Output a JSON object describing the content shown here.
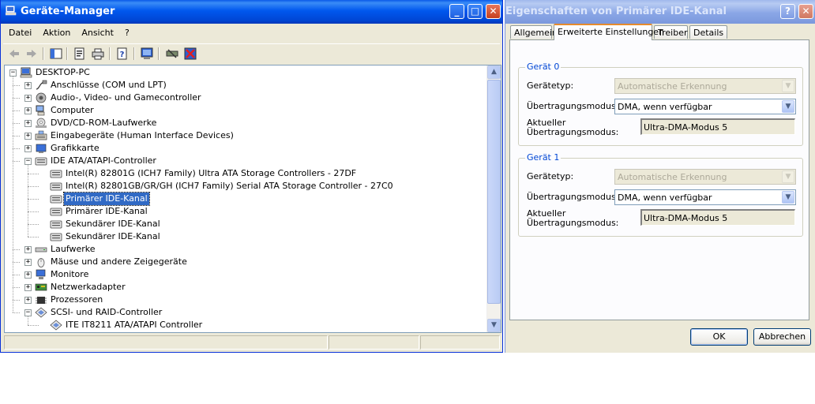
{
  "device_manager": {
    "title": "Geräte-Manager",
    "menu": [
      "Datei",
      "Aktion",
      "Ansicht",
      "?"
    ],
    "toolbar_icons": [
      "back-arrow-icon",
      "forward-arrow-icon",
      "show-hide-console-tree-icon",
      "properties-icon",
      "print-icon",
      "help-icon",
      "scan-hardware-icon",
      "disable-device-icon",
      "uninstall-device-icon"
    ],
    "tree": [
      {
        "label": "DESKTOP-PC",
        "level": 0,
        "expander": "−",
        "icon": "computer-icon"
      },
      {
        "label": "Anschlüsse (COM und LPT)",
        "level": 1,
        "expander": "+",
        "icon": "port-connector-icon"
      },
      {
        "label": "Audio-, Video- und Gamecontroller",
        "level": 1,
        "expander": "+",
        "icon": "speaker-icon"
      },
      {
        "label": "Computer",
        "level": 1,
        "expander": "+",
        "icon": "computer-tower-icon"
      },
      {
        "label": "DVD/CD-ROM-Laufwerke",
        "level": 1,
        "expander": "+",
        "icon": "cd-drive-icon"
      },
      {
        "label": "Eingabegeräte (Human Interface Devices)",
        "level": 1,
        "expander": "+",
        "icon": "keyboard-icon"
      },
      {
        "label": "Grafikkarte",
        "level": 1,
        "expander": "+",
        "icon": "display-adapter-icon"
      },
      {
        "label": "IDE ATA/ATAPI-Controller",
        "level": 1,
        "expander": "−",
        "icon": "ide-controller-icon"
      },
      {
        "label": "Intel(R) 82801G (ICH7 Family) Ultra ATA Storage Controllers - 27DF",
        "level": 2,
        "icon": "ide-controller-icon"
      },
      {
        "label": "Intel(R) 82801GB/GR/GH (ICH7 Family) Serial ATA Storage Controller - 27C0",
        "level": 2,
        "icon": "ide-controller-icon"
      },
      {
        "label": "Primärer IDE-Kanal",
        "level": 2,
        "icon": "ide-controller-icon",
        "selected": true
      },
      {
        "label": "Primärer IDE-Kanal",
        "level": 2,
        "icon": "ide-controller-icon"
      },
      {
        "label": "Sekundärer IDE-Kanal",
        "level": 2,
        "icon": "ide-controller-icon"
      },
      {
        "label": "Sekundärer IDE-Kanal",
        "level": 2,
        "icon": "ide-controller-icon"
      },
      {
        "label": "Laufwerke",
        "level": 1,
        "expander": "+",
        "icon": "hard-drive-icon"
      },
      {
        "label": "Mäuse und andere Zeigegeräte",
        "level": 1,
        "expander": "+",
        "icon": "mouse-icon"
      },
      {
        "label": "Monitore",
        "level": 1,
        "expander": "+",
        "icon": "monitor-icon"
      },
      {
        "label": "Netzwerkadapter",
        "level": 1,
        "expander": "+",
        "icon": "network-card-icon"
      },
      {
        "label": "Prozessoren",
        "level": 1,
        "expander": "+",
        "icon": "processor-icon"
      },
      {
        "label": "SCSI- und RAID-Controller",
        "level": 1,
        "expander": "−",
        "icon": "scsi-controller-icon"
      },
      {
        "label": "ITE IT8211 ATA/ATAPI Controller",
        "level": 2,
        "icon": "scsi-controller-icon"
      }
    ]
  },
  "properties": {
    "title": "Eigenschaften von Primärer IDE-Kanal",
    "tabs": [
      "Allgemein",
      "Erweiterte Einstellungen",
      "Treiber",
      "Details"
    ],
    "active_tab": "Erweiterte Einstellungen",
    "groups": [
      {
        "legend": "Gerät 0",
        "device_type_label": "Gerätetyp:",
        "device_type_value": "Automatische Erkennung",
        "transfer_mode_label": "Übertragungsmodus:",
        "transfer_mode_value": "DMA, wenn verfügbar",
        "current_mode_label": "Aktueller Übertragungsmodus:",
        "current_mode_value": "Ultra-DMA-Modus 5"
      },
      {
        "legend": "Gerät 1",
        "device_type_label": "Gerätetyp:",
        "device_type_value": "Automatische Erkennung",
        "transfer_mode_label": "Übertragungsmodus:",
        "transfer_mode_value": "DMA, wenn verfügbar",
        "current_mode_label": "Aktueller Übertragungsmodus:",
        "current_mode_value": "Ultra-DMA-Modus 5"
      }
    ],
    "buttons": {
      "ok": "OK",
      "cancel": "Abbrechen"
    }
  },
  "colors": {
    "titlebar_active": "#0058ee",
    "selection": "#316ac5",
    "window_face": "#ece9d8",
    "group_legend": "#0046d5",
    "active_tab_highlight": "#e68b2c"
  }
}
